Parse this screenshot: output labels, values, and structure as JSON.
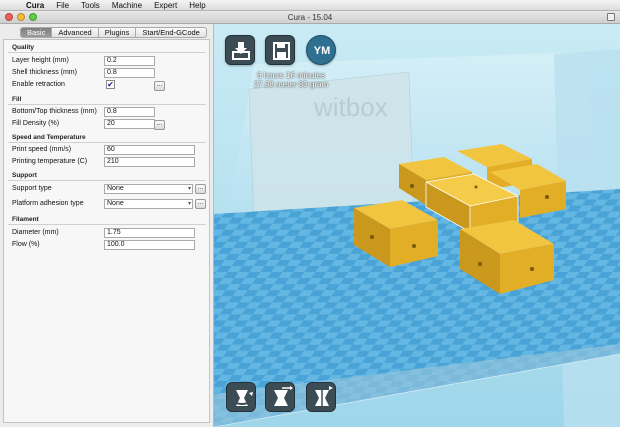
{
  "menubar": {
    "apple": "",
    "items": [
      "Cura",
      "File",
      "Tools",
      "Machine",
      "Expert",
      "Help"
    ]
  },
  "window": {
    "title": "Cura - 15.04"
  },
  "tabs": [
    "Basic",
    "Advanced",
    "Plugins",
    "Start/End-GCode"
  ],
  "quality": {
    "title": "Quality",
    "layer_height_label": "Layer height (mm)",
    "layer_height": "0.2",
    "shell_thickness_label": "Shell thickness (mm)",
    "shell_thickness": "0.8",
    "retraction_label": "Enable retraction",
    "retraction_mark": "✔"
  },
  "fill": {
    "title": "Fill",
    "bottom_top_label": "Bottom/Top thickness (mm)",
    "bottom_top": "0.8",
    "density_label": "Fill Density (%)",
    "density": "20"
  },
  "speed": {
    "title": "Speed and Temperature",
    "print_speed_label": "Print speed (mm/s)",
    "print_speed": "60",
    "temp_label": "Printing temperature (C)",
    "temp": "210"
  },
  "support": {
    "title": "Support",
    "type_label": "Support type",
    "type": "None",
    "adhesion_label": "Platform adhesion type",
    "adhesion": "None"
  },
  "filament": {
    "title": "Filament",
    "diameter_label": "Diameter (mm)",
    "diameter": "1.75",
    "flow_label": "Flow (%)",
    "flow": "100.0"
  },
  "buttons": {
    "dots": "...",
    "arrow": "▾"
  },
  "viewport": {
    "ym_label": "YM",
    "time_estimate": "6 hours 16 minutes",
    "material_estimate": "27.98 meter 83 gram",
    "machine_logo": "witbox",
    "colors": {
      "plate": "#5fb2de",
      "part": "#e8b82a",
      "part_side": "#c9981c"
    }
  }
}
